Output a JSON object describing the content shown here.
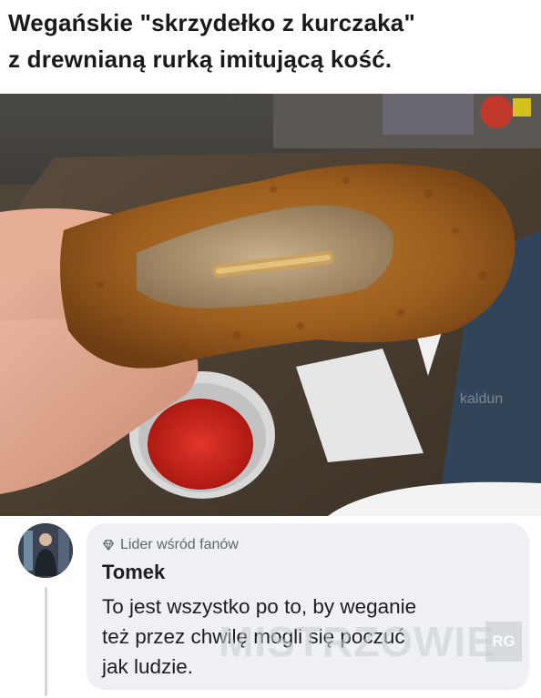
{
  "meme": {
    "title_line_1": "Wegańskie \"skrzydełko z kurczaka\"",
    "title_line_2": "z drewnianą rurką imitującą kość.",
    "photo_watermark": "kaldun"
  },
  "comment": {
    "badge_icon": "diamond-icon",
    "badge": "Lider wśród fanów",
    "author": "Tomek",
    "text_line_1": "To jest wszystko po to, by weganie",
    "text_line_2": "też przez chwilę mogli się poczuć",
    "text_line_3": "jak ludzie."
  },
  "site_watermark": {
    "text": "MISTRZOWIE",
    "suffix": "RG"
  },
  "colors": {
    "bubble": "#eef0f3",
    "badge_text": "#5f6670",
    "name_text": "#1c1e21",
    "thread_line": "#d0d3d8"
  }
}
